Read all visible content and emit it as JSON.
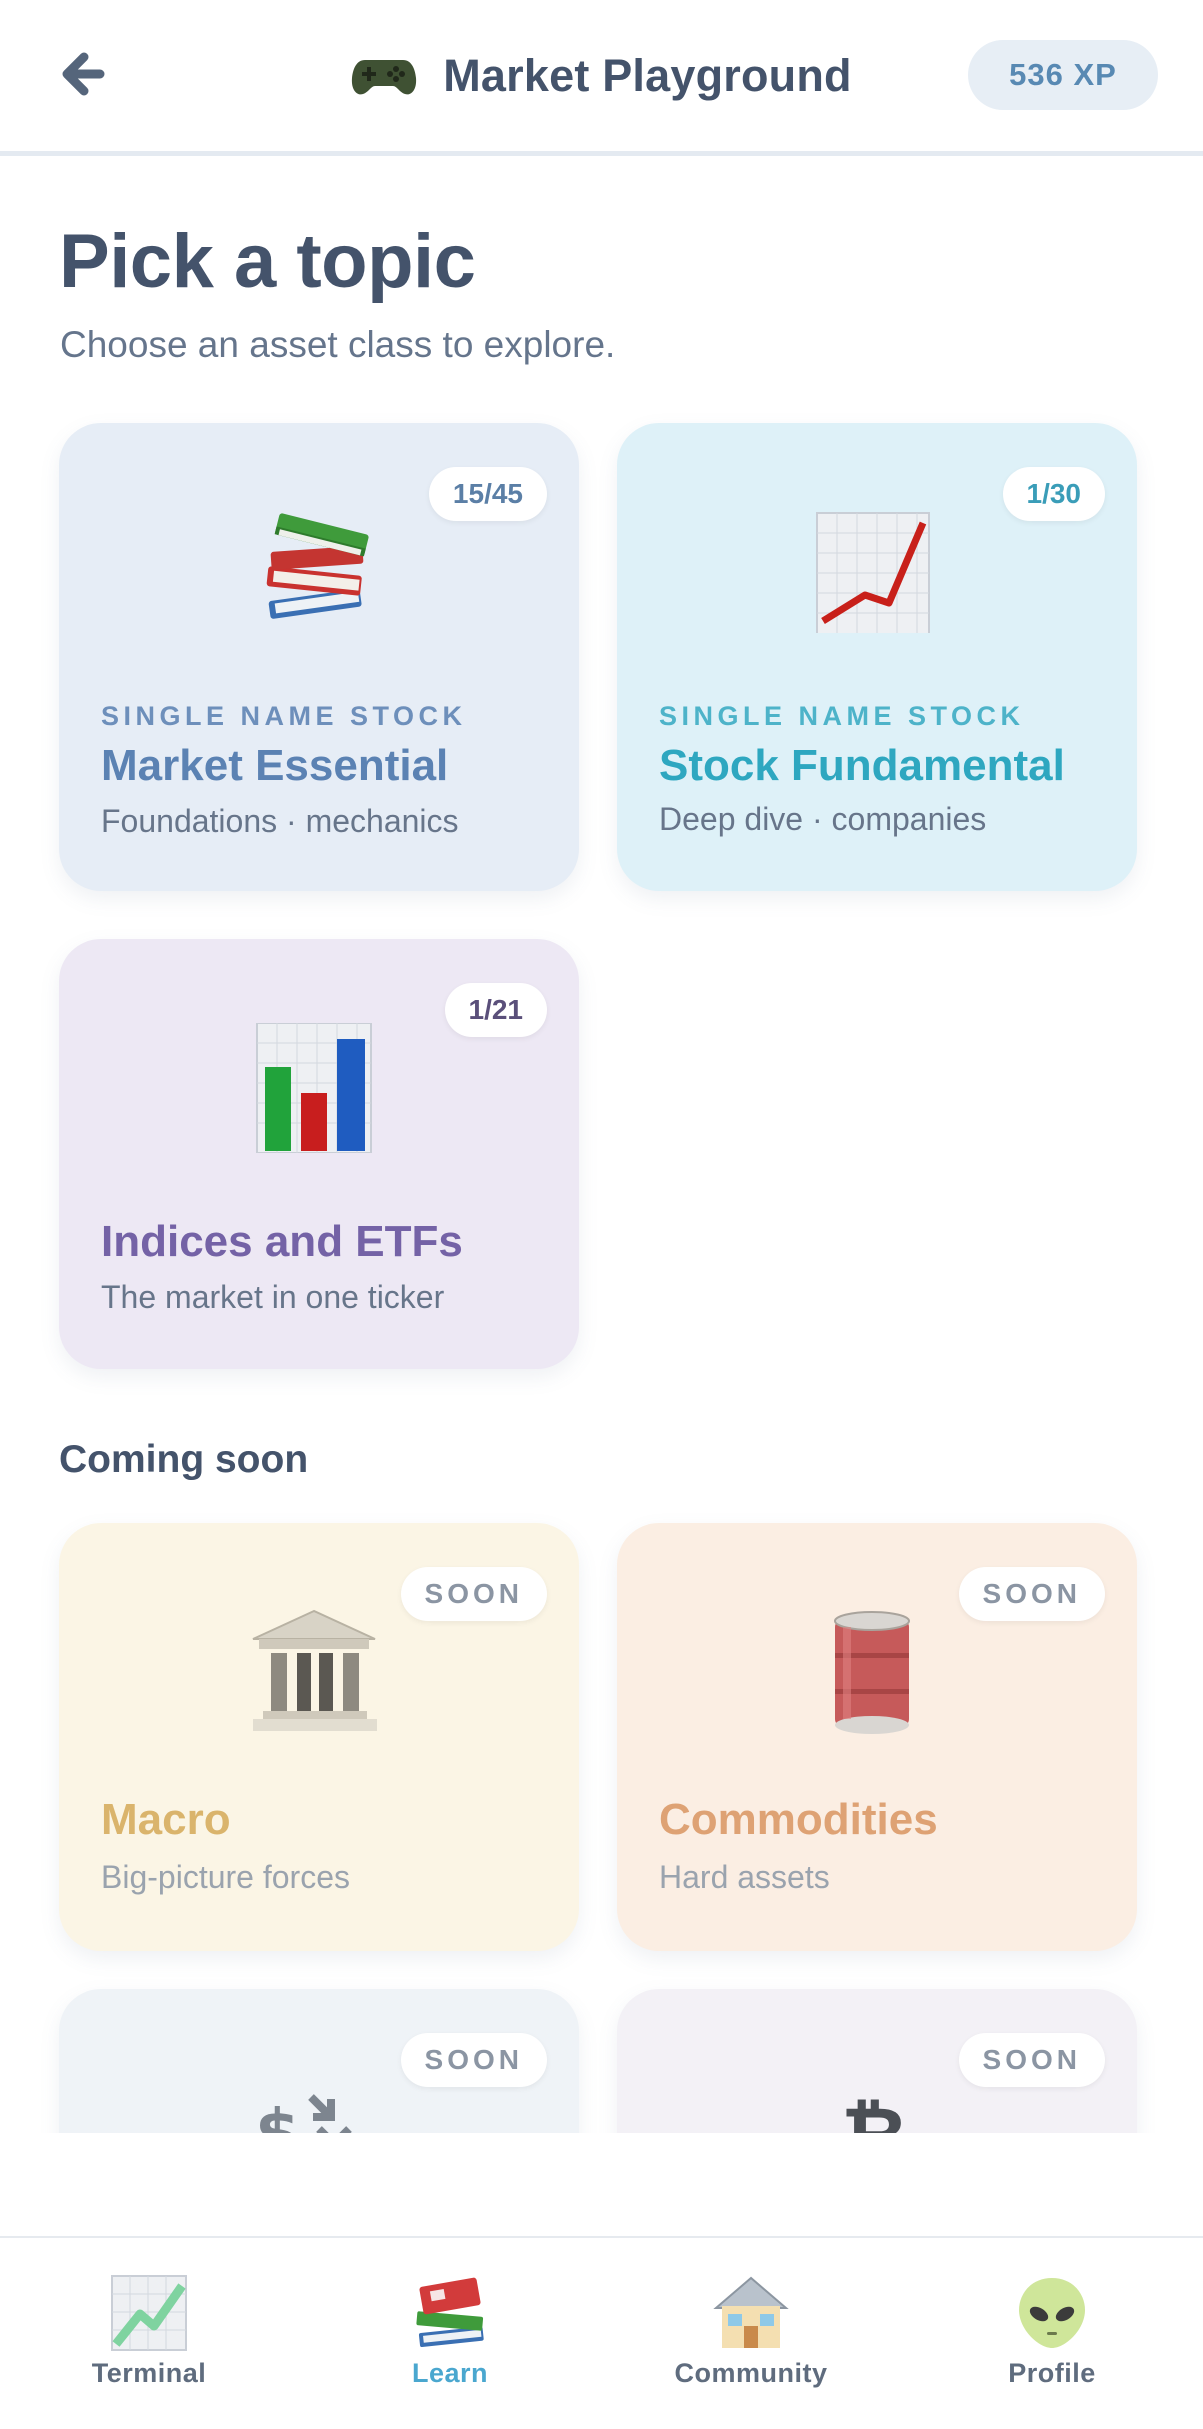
{
  "header": {
    "back_icon": "arrow-left-icon",
    "title_icon": "gamepad-icon",
    "title": "Market Playground",
    "xp": "536 XP"
  },
  "intro": {
    "title": "Pick a topic",
    "subtitle": "Choose an asset class to explore."
  },
  "topics": [
    {
      "icon": "books-icon",
      "badge": "15/45",
      "kicker": "SINGLE NAME STOCK",
      "name": "Market Essential",
      "desc": "Foundations · mechanics",
      "accent": "#5b82b3"
    },
    {
      "icon": "chart-up-icon",
      "badge": "1/30",
      "kicker": "SINGLE NAME STOCK",
      "name": "Stock Fundamental",
      "desc": "Deep dive · companies",
      "accent": "#2ea7c0"
    },
    {
      "icon": "bar-chart-icon",
      "badge": "1/21",
      "kicker": "",
      "name": "Indices and ETFs",
      "desc": "The market in one ticker",
      "accent": "#7462a6"
    }
  ],
  "coming_soon": {
    "title": "Coming soon",
    "items": [
      {
        "icon": "classical-building-icon",
        "badge": "SOON",
        "name": "Macro",
        "desc": "Big-picture forces",
        "accent": "#d9b56e"
      },
      {
        "icon": "oil-drum-icon",
        "badge": "SOON",
        "name": "Commodities",
        "desc": "Hard assets",
        "accent": "#dfa573"
      },
      {
        "icon": "currency-exchange-icon",
        "badge": "SOON"
      },
      {
        "icon": "bitcoin-icon",
        "badge": "SOON"
      }
    ]
  },
  "nav": {
    "items": [
      {
        "icon": "chart-icon",
        "label": "Terminal"
      },
      {
        "icon": "books-icon",
        "label": "Learn",
        "active": true
      },
      {
        "icon": "house-icon",
        "label": "Community"
      },
      {
        "icon": "alien-icon",
        "label": "Profile"
      }
    ],
    "active_color": "#4aa7cf"
  }
}
